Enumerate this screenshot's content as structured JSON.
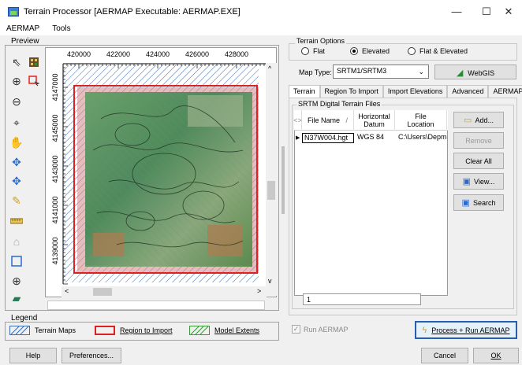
{
  "window": {
    "title": "Terrain Processor [AERMAP Executable: AERMAP.EXE]",
    "minimize_glyph": "—",
    "maximize_glyph": "☐",
    "close_glyph": "✕"
  },
  "menu": {
    "items": [
      "AERMAP",
      "Tools"
    ]
  },
  "preview": {
    "label": "Preview",
    "x_ticks": [
      "420000",
      "422000",
      "424000",
      "426000",
      "428000"
    ],
    "y_ticks": [
      "4147000",
      "4145000",
      "4143000",
      "4141000",
      "4139000"
    ],
    "tools": [
      "pointer-icon",
      "terrain-grid-icon",
      "zoom-in-icon",
      "select-region-icon",
      "zoom-out-icon",
      "crosshair-icon",
      "pan-hand-icon",
      "move-icon",
      "move-alt-icon",
      "pencil-icon",
      "ruler-icon",
      "building-icon",
      "boundary-box-icon",
      "globe-icon",
      "layers-icon"
    ]
  },
  "legend": {
    "label": "Legend",
    "items": [
      {
        "label": "Terrain Maps",
        "color": "#3d6db5"
      },
      {
        "label": "Region to Import",
        "color": "#e02020"
      },
      {
        "label": "Model Extents",
        "color": "#3a9a3a"
      }
    ]
  },
  "terrain_options": {
    "label": "Terrain Options",
    "radios": [
      {
        "label": "Flat",
        "selected": false
      },
      {
        "label": "Elevated",
        "selected": true
      },
      {
        "label": "Flat & Elevated",
        "selected": false
      }
    ]
  },
  "map_type": {
    "label": "Map Type:",
    "value": "SRTM1/SRTM3",
    "arrow": "⌄"
  },
  "webgis_label": "WebGIS",
  "tabs": [
    "Terrain",
    "Region To Import",
    "Import Elevations",
    "Advanced",
    "AERMAP"
  ],
  "srtm": {
    "label": "SRTM Digital Terrain Files",
    "columns": {
      "arrow": "<>",
      "file_name": "File Name",
      "sort": "/",
      "datum_1": "Horizontal",
      "datum_2": "Datum",
      "location_1": "File",
      "location_2": "Location"
    },
    "row": {
      "marker": "▶",
      "file_name": "N37W004.hgt",
      "datum": "WGS 84",
      "location": "C:\\Users\\Depme"
    },
    "footer_count": "1"
  },
  "side_buttons": {
    "add": "Add...",
    "remove": "Remove",
    "clear_all": "Clear All",
    "view": "View...",
    "search": "Search"
  },
  "run_aermap": {
    "label": "Run AERMAP",
    "checked": true,
    "check_glyph": "✓"
  },
  "process_label": "Process + Run AERMAP",
  "bottom": {
    "help": "Help",
    "preferences": "Preferences...",
    "cancel": "Cancel",
    "ok": "OK"
  }
}
